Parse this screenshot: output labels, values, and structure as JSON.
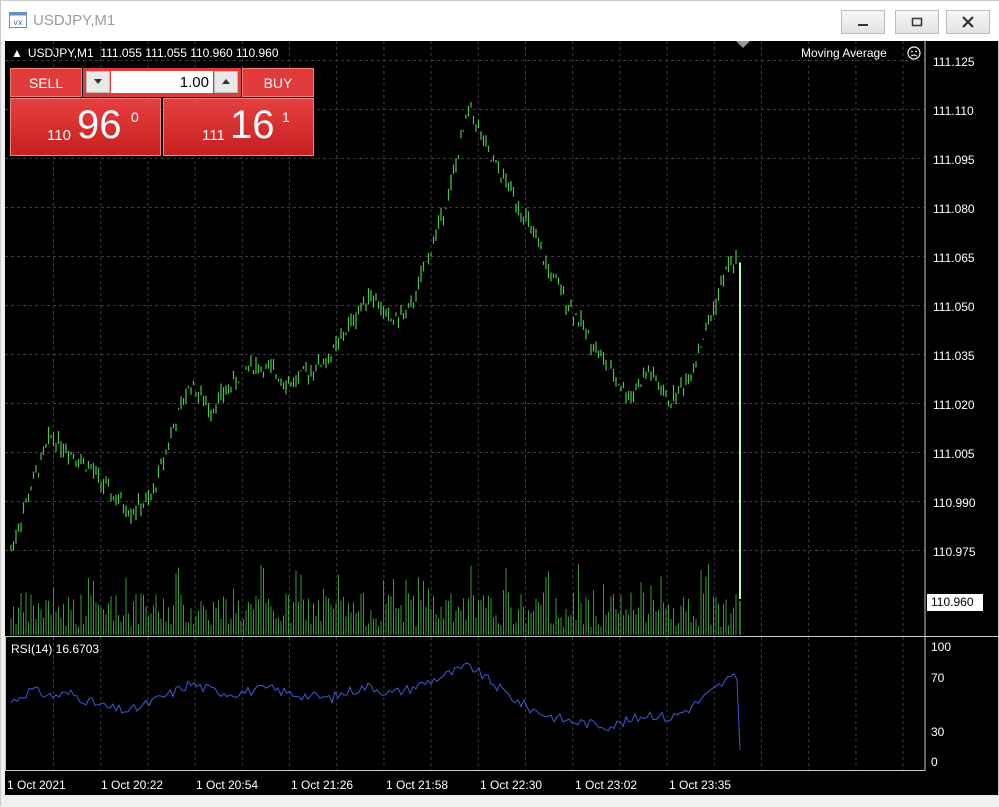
{
  "window": {
    "title": "USDJPY,M1"
  },
  "chart": {
    "header": "USDJPY,M1  111.055 111.055 110.960 110.960",
    "indicator_name": "Moving Average",
    "rsi_label": "RSI(14) 16.6703",
    "current_price": "110.960",
    "colors": {
      "candle": "#4ec44e",
      "volume": "#3a9a3a",
      "rsi": "#3b5bd6",
      "grid": "#3b3b3b",
      "last_bar": "#b8ffb8"
    }
  },
  "trade": {
    "sell_label": "SELL",
    "buy_label": "BUY",
    "lot": "1.00",
    "sell_small": "110",
    "sell_big": "96",
    "sell_sup": "0",
    "buy_small": "111",
    "buy_big": "16",
    "buy_sup": "1"
  },
  "price_axis": [
    "111.125",
    "111.110",
    "111.095",
    "111.080",
    "111.065",
    "111.050",
    "111.035",
    "111.020",
    "111.005",
    "110.990",
    "110.975"
  ],
  "rsi_axis": [
    "100",
    "70",
    "30",
    "0"
  ],
  "time_axis": [
    "1 Oct 2021",
    "1 Oct 20:22",
    "1 Oct 20:54",
    "1 Oct 21:26",
    "1 Oct 21:58",
    "1 Oct 22:30",
    "1 Oct 23:02",
    "1 Oct 23:35"
  ],
  "chart_data": {
    "type": "line",
    "x": [
      0,
      8,
      16,
      24,
      32,
      40,
      48,
      56,
      64,
      72,
      80,
      88,
      96,
      104,
      112,
      120,
      128,
      136,
      144,
      152,
      160,
      168,
      176,
      184,
      192,
      200,
      208,
      216,
      224,
      232,
      240,
      248,
      256,
      264,
      272,
      280,
      288,
      292
    ],
    "series": [
      {
        "values": [
          110.975,
          110.994,
          111.01,
          111.005,
          111.0,
          110.992,
          110.987,
          110.99,
          111.01,
          111.026,
          111.018,
          111.025,
          111.032,
          111.03,
          111.026,
          111.03,
          111.034,
          111.044,
          111.054,
          111.045,
          111.048,
          111.066,
          111.085,
          111.111,
          111.095,
          111.086,
          111.074,
          111.06,
          111.05,
          111.04,
          111.03,
          111.022,
          111.03,
          111.02,
          111.028,
          111.045,
          111.063,
          110.96
        ]
      },
      {
        "values": [
          55,
          65,
          60,
          62,
          55,
          50,
          48,
          55,
          62,
          70,
          65,
          62,
          64,
          66,
          62,
          60,
          58,
          64,
          68,
          62,
          66,
          72,
          78,
          84,
          72,
          60,
          50,
          44,
          40,
          38,
          36,
          40,
          46,
          42,
          50,
          62,
          74,
          16.67
        ]
      }
    ]
  }
}
